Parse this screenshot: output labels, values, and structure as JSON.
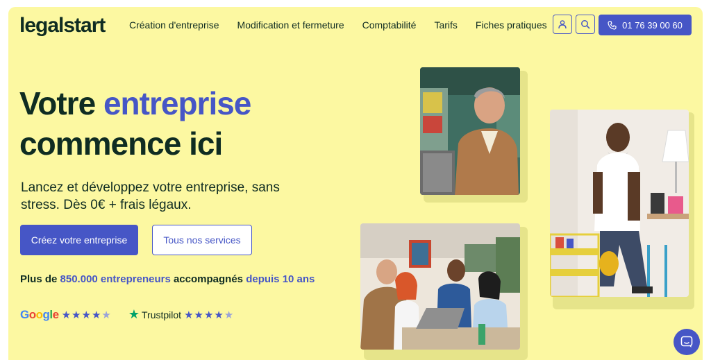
{
  "header": {
    "logo": "legalstart",
    "nav": [
      "Création d'entreprise",
      "Modification et fermeture",
      "Comptabilité",
      "Tarifs",
      "Fiches pratiques"
    ],
    "phone": "01 76 39 00 60",
    "account_icon": "user-icon",
    "search_icon": "search-icon"
  },
  "hero": {
    "title_part1": "Votre",
    "title_accent": "entreprise",
    "title_part2": "commence ici",
    "subtitle": "Lancez et développez votre entreprise, sans stress. Dès 0€ + frais légaux.",
    "cta_primary": "Créez votre entreprise",
    "cta_secondary": "Tous nos services",
    "stats_1": "Plus de",
    "stats_accent_1": "850.000 entrepreneurs",
    "stats_2": "accompagnés",
    "stats_accent_2": "depuis 10 ans"
  },
  "ratings": {
    "google_label": "Google",
    "google_stars": 4.5,
    "trustpilot_label": "Trustpilot",
    "trustpilot_stars": 4.5
  },
  "colors": {
    "background": "#fcf8a1",
    "accent": "#4656c6",
    "text": "#0f2c22"
  }
}
